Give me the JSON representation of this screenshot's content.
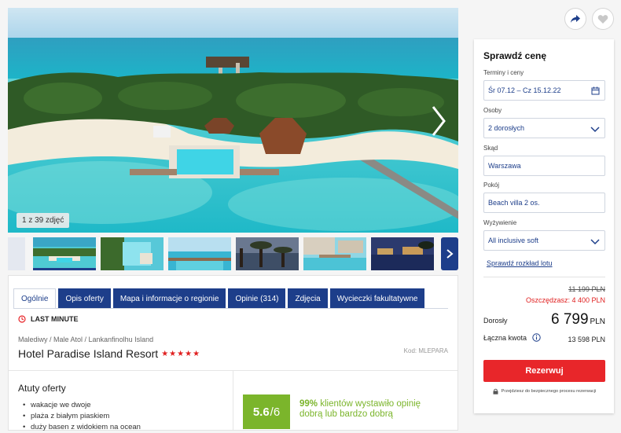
{
  "gallery": {
    "counter": "1 z 39 zdjęć",
    "next_icon": "chevron-right-icon",
    "thumbs_next_icon": "chevron-right-icon"
  },
  "tabs": [
    {
      "label": "Ogólnie",
      "active": true
    },
    {
      "label": "Opis oferty",
      "active": false
    },
    {
      "label": "Mapa i informacje o regionie",
      "active": false
    },
    {
      "label": "Opinie (314)",
      "active": false
    },
    {
      "label": "Zdjęcia",
      "active": false
    },
    {
      "label": "Wycieczki fakultatywne",
      "active": false
    }
  ],
  "offer": {
    "badge": "LAST MINUTE",
    "breadcrumb": "Malediwy / Male Atol / Lankanfinolhu Island",
    "hotel_name": "Hotel Paradise Island Resort",
    "stars": "★★★★★",
    "star_count": 5,
    "code": "Kod: MLEPARA"
  },
  "highlights": {
    "title": "Atuty oferty",
    "items": [
      "wakacje we dwoje",
      "plaża z białym piaskiem",
      "duży basen z widokiem na ocean"
    ]
  },
  "rating": {
    "score": "5.6",
    "scale": "/6",
    "percent": "99%",
    "text": "klientów wystawiło opinię dobrą lub bardzo dobrą"
  },
  "price_card": {
    "title": "Sprawdź cenę",
    "fields": {
      "dates_label": "Terminy i ceny",
      "dates_value": "Śr 07.12 – Cz 15.12.22",
      "persons_label": "Osoby",
      "persons_value": "2 dorosłych",
      "from_label": "Skąd",
      "from_value": "Warszawa",
      "room_label": "Pokój",
      "room_value": "Beach villa 2 os.",
      "board_label": "Wyżywienie",
      "board_value": "All inclusive soft"
    },
    "flight_link": "Sprawdź rozkład lotu",
    "old_price": "11 199 PLN",
    "savings": "Oszczędzasz: 4 400 PLN",
    "adult_label": "Dorosły",
    "adult_price": "6 799",
    "currency": "PLN",
    "total_label": "Łączna kwota",
    "total_value": "13 598 PLN",
    "book_button": "Rezerwuj",
    "secure_note": "Przejdziesz do bezpiecznego procesu rezerwacji"
  },
  "colors": {
    "navy": "#1d3e8a",
    "red": "#e8262a",
    "green": "#7bb52b"
  }
}
